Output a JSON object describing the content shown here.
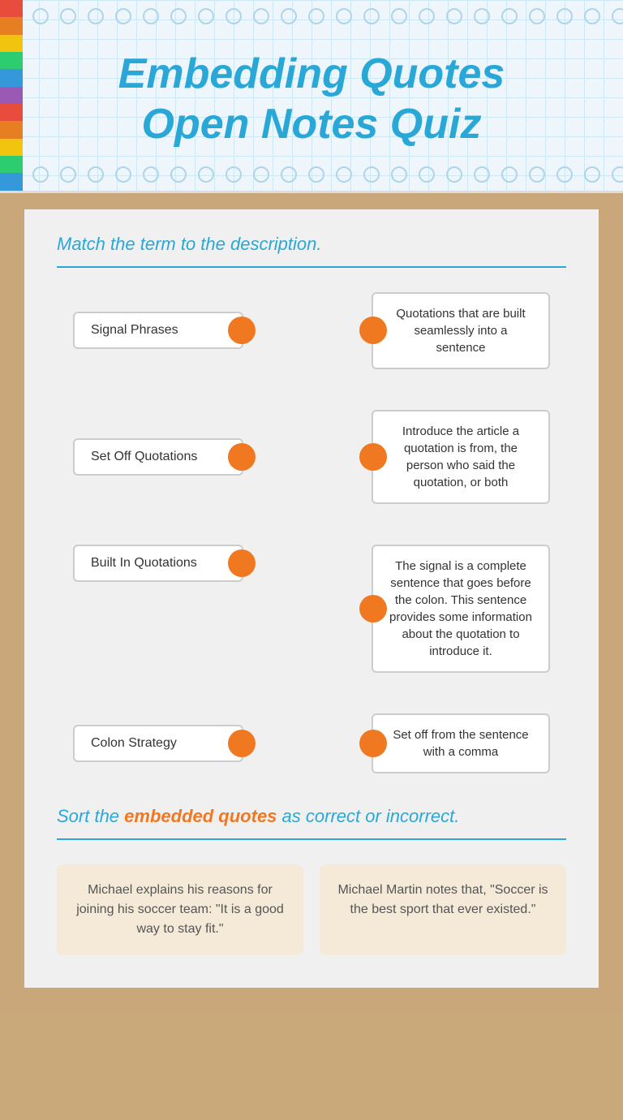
{
  "header": {
    "title_line1": "Embedding Quotes",
    "title_line2": "Open Notes Quiz"
  },
  "match_section": {
    "label": "Match the term to the description.",
    "terms": [
      {
        "id": "term1",
        "label": "Signal Phrases"
      },
      {
        "id": "term2",
        "label": "Set Off Quotations"
      },
      {
        "id": "term3",
        "label": "Built In Quotations"
      },
      {
        "id": "term4",
        "label": "Colon Strategy"
      }
    ],
    "descriptions": [
      {
        "id": "desc1",
        "text": "Quotations that are built seamlessly into a sentence"
      },
      {
        "id": "desc2",
        "text": "Introduce the article a quotation is from, the person who said the quotation, or both"
      },
      {
        "id": "desc3",
        "text": "The signal is a complete sentence that goes before the colon. This sentence provides some information about the quotation to introduce it."
      },
      {
        "id": "desc4",
        "text": "Set off from the sentence with a comma"
      }
    ]
  },
  "sort_section": {
    "label_part1": "Sort the",
    "label_highlight": "embedded quotes",
    "label_part2": "as correct or incorrect.",
    "cards": [
      {
        "text": "Michael explains his reasons for joining his soccer team: \"It is a good way to stay fit.\""
      },
      {
        "text": "Michael Martin notes that, \"Soccer is the best sport that ever existed.\""
      }
    ]
  },
  "tape_colors": [
    "#e74c3c",
    "#e67e22",
    "#f1c40f",
    "#2ecc71",
    "#3498db",
    "#9b59b6",
    "#e74c3c",
    "#e67e22",
    "#f1c40f",
    "#2ecc71",
    "#3498db"
  ]
}
